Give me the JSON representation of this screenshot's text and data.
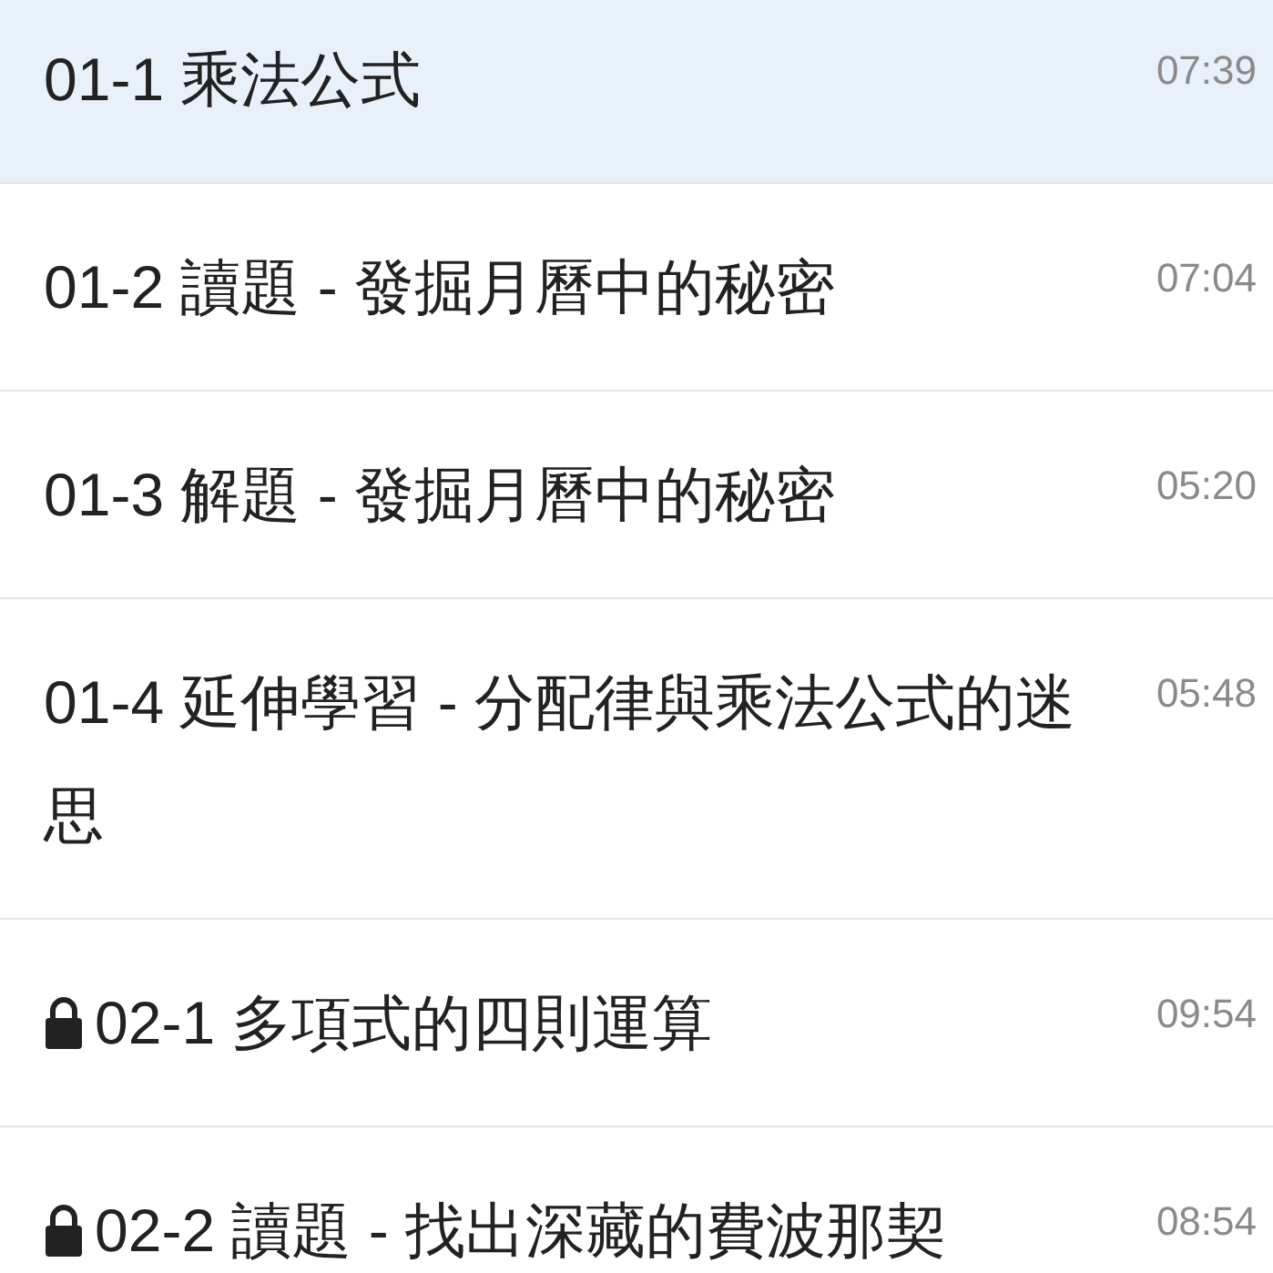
{
  "lessons": [
    {
      "title": "01-1 乘法公式",
      "duration": "07:39",
      "locked": false,
      "selected": true
    },
    {
      "title": "01-2 讀題 - 發掘月曆中的秘密",
      "duration": "07:04",
      "locked": false,
      "selected": false
    },
    {
      "title": "01-3 解題 - 發掘月曆中的秘密",
      "duration": "05:20",
      "locked": false,
      "selected": false
    },
    {
      "title": "01-4 延伸學習 - 分配律與乘法公式的迷思",
      "duration": "05:48",
      "locked": false,
      "selected": false
    },
    {
      "title": "02-1 多項式的四則運算",
      "duration": "09:54",
      "locked": true,
      "selected": false
    },
    {
      "title": "02-2 讀題 - 找出深藏的費波那契",
      "duration": "08:54",
      "locked": true,
      "selected": false
    }
  ]
}
